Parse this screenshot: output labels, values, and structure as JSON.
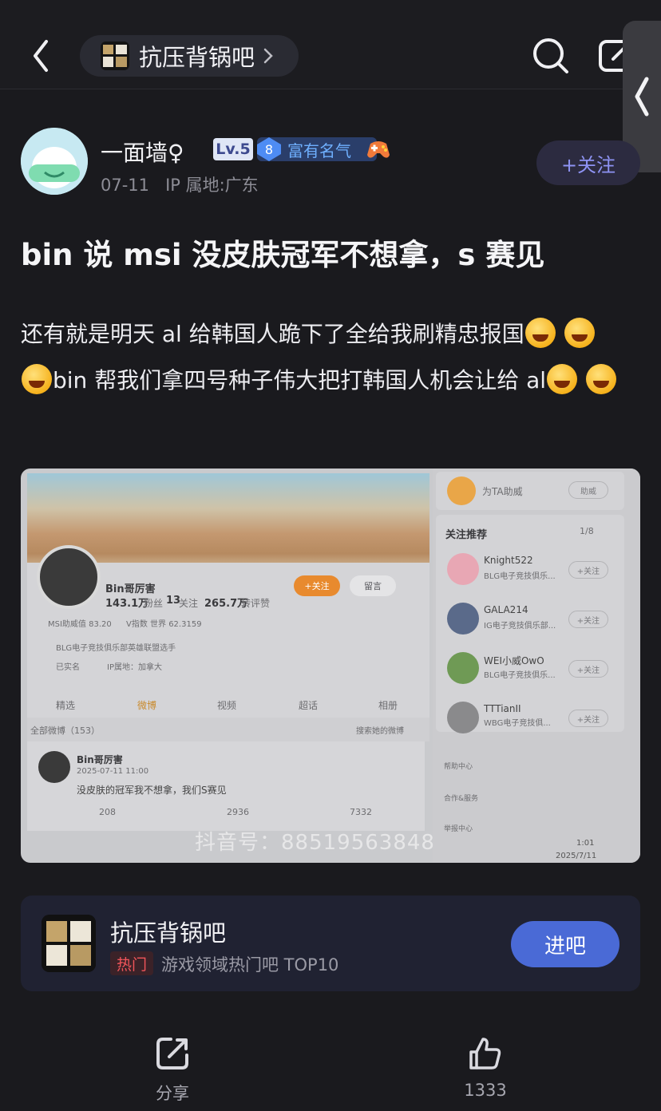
{
  "header": {
    "forum_name": "抗压背锅吧",
    "forum_logo_text": "抗压背锅吧"
  },
  "author": {
    "name": "一面墙♀",
    "level": "Lv.5",
    "badge_number": "8",
    "badge_text": "富有名气",
    "date": "07-11",
    "ip": "IP 属地:广东",
    "follow_label": "+关注"
  },
  "post": {
    "title": "bin 说 msi 没皮肤冠军不想拿，s 赛见",
    "body_1": "还有就是明天 al 给韩国人跪下了全给我刷精忠报国",
    "body_2": "bin 帮我们拿四号种子伟大把打韩国人机会让给 al"
  },
  "screenshot": {
    "profile_name": "Bin哥厉害",
    "fans": "143.1万",
    "fans_label": "粉丝",
    "follows": "13",
    "follows_label": "关注",
    "likes": "265.7万",
    "likes_label": "转评赞",
    "follow_btn": "+关注",
    "message_btn": "留言",
    "stat_1": "MSI助威值 83.20",
    "stat_2": "V指数 世界 62.3159",
    "bio": "BLG电子竞技俱乐部英雄联盟选手",
    "verified": "已实名",
    "ip_line": "IP属地：加拿大",
    "tabs": [
      "精选",
      "微博",
      "视频",
      "超话",
      "相册"
    ],
    "feed_label": "全部微博（153）",
    "search_placeholder": "搜索她的微博",
    "post_author": "Bin哥厉害",
    "post_time": "2025-07-11 11:00",
    "post_text": "没皮肤的冠军我不想拿，我们S赛见",
    "reposts": "208",
    "comments": "2936",
    "post_likes": "7332",
    "support_label": "为TA助威",
    "support_btn": "助威",
    "recommend_title": "关注推荐",
    "recommend_page": "1/8",
    "recommend": [
      {
        "name": "Knight522",
        "desc": "BLG电子竞技俱乐...",
        "btn": "+关注"
      },
      {
        "name": "GALA214",
        "desc": "IG电子竞技俱乐部...",
        "btn": "+关注"
      },
      {
        "name": "WEI小威OwO",
        "desc": "BLG电子竞技俱乐...",
        "btn": "+关注"
      },
      {
        "name": "TTTianII",
        "desc": "WBG电子竞技俱...",
        "btn": "+关注"
      }
    ],
    "help_center": "帮助中心",
    "coop": "合作&服务",
    "report": "举报中心",
    "watermark": "抖音号：88519563848",
    "clock_time": "1:01",
    "clock_date": "2025/7/11"
  },
  "forum_card": {
    "name": "抗压背锅吧",
    "hot_tag": "热门",
    "rank_text": "游戏领域热门吧 TOP10",
    "enter_label": "进吧"
  },
  "bottom": {
    "share_label": "分享",
    "like_count": "1333"
  }
}
